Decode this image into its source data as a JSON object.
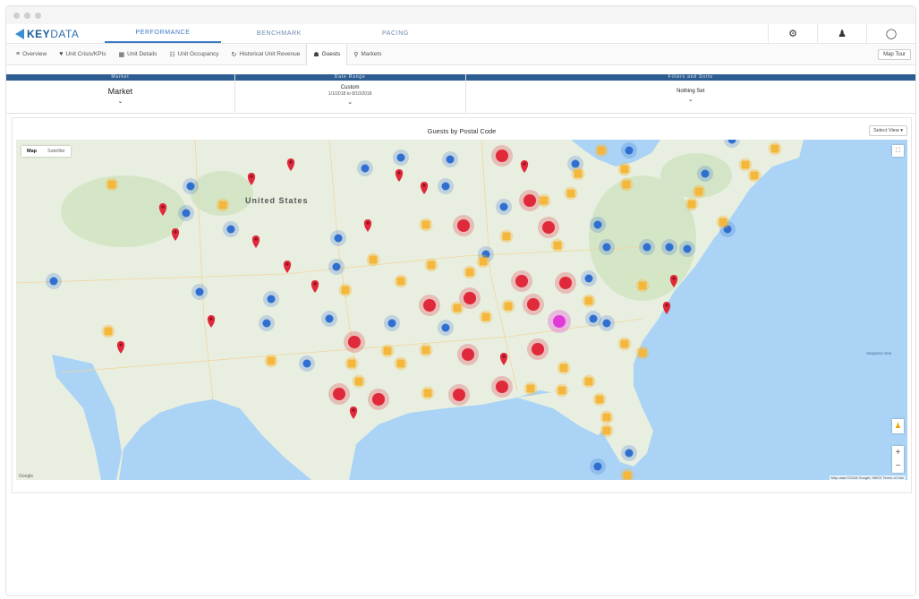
{
  "app": {
    "brand_prefix": "KEY",
    "brand_suffix": "DATA"
  },
  "main_tabs": [
    {
      "label": "PERFORMANCE",
      "active": true
    },
    {
      "label": "BENCHMARK",
      "active": false
    },
    {
      "label": "PACING",
      "active": false
    }
  ],
  "top_icons": [
    {
      "name": "settings-icon",
      "glyph": "⚙"
    },
    {
      "name": "notification-bell-icon",
      "glyph": "♟"
    },
    {
      "name": "account-icon",
      "glyph": "◯"
    }
  ],
  "sub_tabs": [
    {
      "label": "Overview",
      "icon": "≡",
      "icon_name": "overview-icon",
      "active": false
    },
    {
      "label": "Unit Crisis/KPIs",
      "icon": "♥",
      "icon_name": "kpi-icon",
      "active": false
    },
    {
      "label": "Unit Details",
      "icon": "▦",
      "icon_name": "unit-details-icon",
      "active": false
    },
    {
      "label": "Unit Occupancy",
      "icon": "☷",
      "icon_name": "occupancy-icon",
      "active": false
    },
    {
      "label": "Historical Unit Revenue",
      "icon": "↻",
      "icon_name": "history-icon",
      "active": false
    },
    {
      "label": "Guests",
      "icon": "☗",
      "icon_name": "guests-icon",
      "active": true
    },
    {
      "label": "Markets",
      "icon": "⚲",
      "icon_name": "markets-icon",
      "active": false
    }
  ],
  "map_tour_label": "Map Tour",
  "filters": {
    "market": {
      "header": "Market",
      "value": "Market"
    },
    "date_range": {
      "header": "Date Range",
      "value": "Custom",
      "range": "1/1/2018 to 8/10/2018"
    },
    "filters_sorts": {
      "header": "Filters and Sorts",
      "value": "Nothing Set"
    }
  },
  "card": {
    "title": "Guests by Postal Code",
    "select_view_label": "Select View ▾"
  },
  "map": {
    "toggle": [
      "Map",
      "Satellite"
    ],
    "country_label": "United States",
    "sea_label": "Sargasso Sea",
    "footer": "Map data ©2018 Google, INEGI  Terms of Use",
    "google_label": "Google",
    "zoom_in": "+",
    "zoom_out": "−",
    "colors": {
      "land": "#e8efe0",
      "water": "#aad3f5",
      "blue_marker": "#2f6fd1",
      "red_marker": "#e0293a",
      "red_cluster": "#e0293a",
      "yellow_cluster": "#f5b73b",
      "magenta_cluster": "#e23ad8"
    }
  }
}
